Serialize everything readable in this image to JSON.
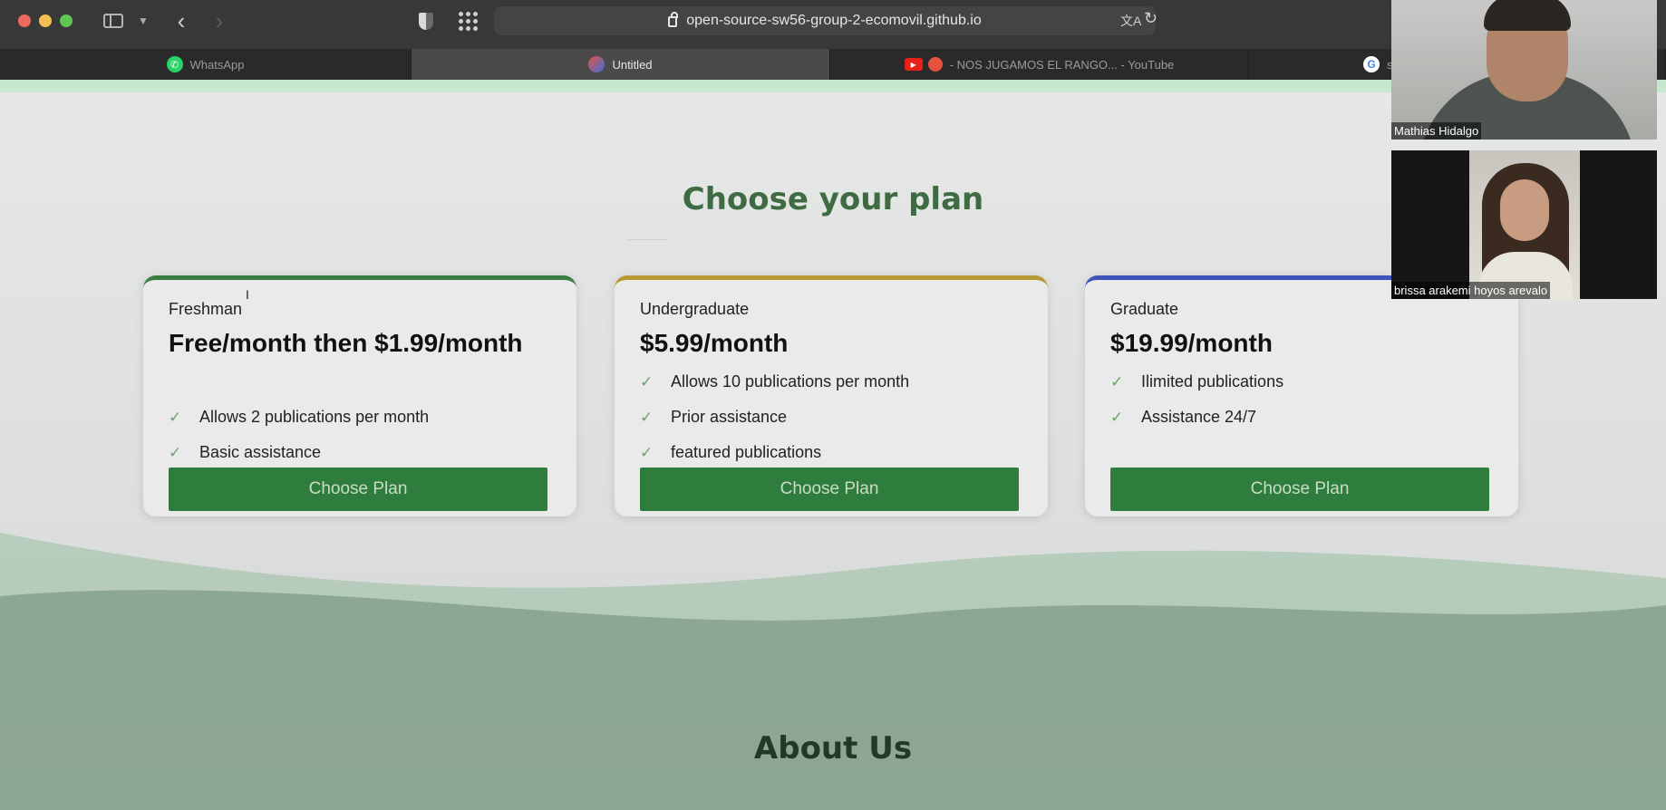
{
  "browser": {
    "url": "open-source-sw56-group-2-ecomovil.github.io",
    "tabs": [
      {
        "label": "WhatsApp",
        "active": false
      },
      {
        "label": "Untitled",
        "active": true
      },
      {
        "label": "- NOS JUGAMOS EL RANGO... - YouTube",
        "active": false
      },
      {
        "label": "s",
        "active": false
      }
    ]
  },
  "page": {
    "plans_title": "Choose your plan",
    "about_title": "About Us",
    "plans": [
      {
        "name": "Freshman",
        "price": "Free/month then $1.99/month",
        "accent": "#3a7d44",
        "features": [
          "Allows 2 publications per month",
          "Basic assistance"
        ],
        "button": "Choose Plan"
      },
      {
        "name": "Undergraduate",
        "price": "$5.99/month",
        "accent": "#b79a35",
        "features": [
          "Allows 10 publications per month",
          "Prior assistance",
          "featured publications"
        ],
        "button": "Choose Plan"
      },
      {
        "name": "Graduate",
        "price": "$19.99/month",
        "accent": "#3f54b8",
        "features": [
          "Ilimited publications",
          "Assistance 24/7"
        ],
        "button": "Choose Plan"
      }
    ]
  },
  "call": {
    "participants": [
      {
        "name": "Mathias Hidalgo"
      },
      {
        "name": "brissa arakemi hoyos arevalo"
      }
    ]
  },
  "colors": {
    "brand_green": "#2f7d3c",
    "title_green": "#3f6b43"
  }
}
